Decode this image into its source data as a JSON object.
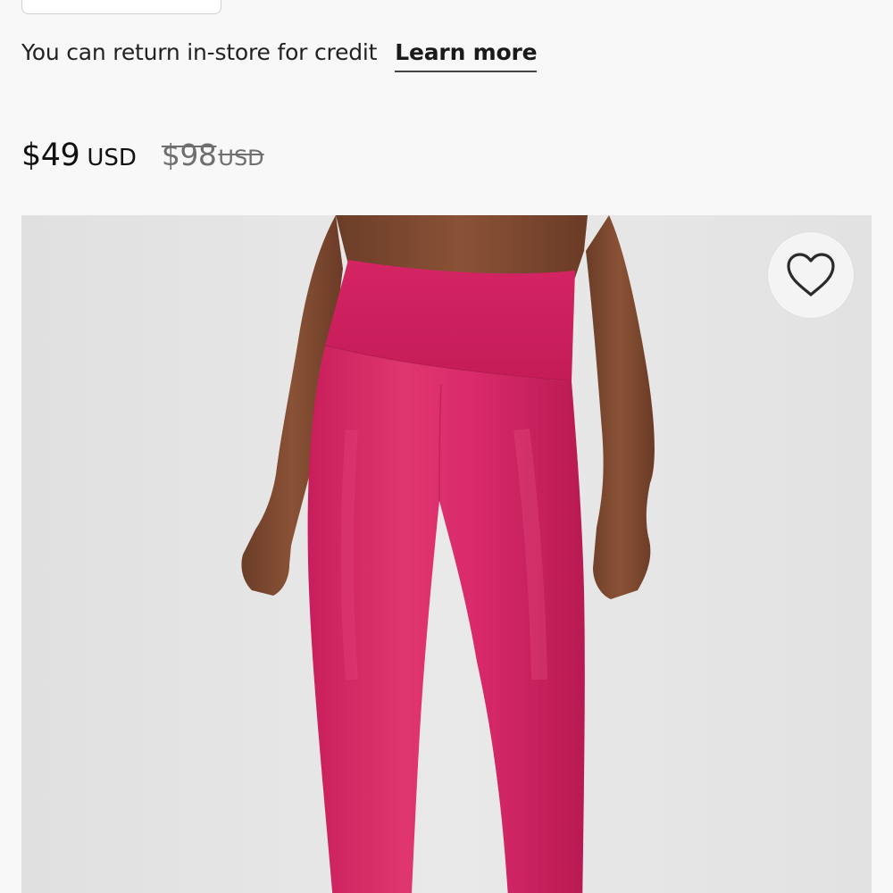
{
  "returns": {
    "text": "You can return in-store for credit",
    "link_label": "Learn more"
  },
  "price": {
    "current_amount": "$49",
    "current_currency": "USD",
    "original_amount": "$98",
    "original_currency": "USD"
  },
  "product_image": {
    "subject": "pink high-rise leggings",
    "leggings_color": "#d92a6a",
    "background_color": "#e4e4e4"
  },
  "wishlist": {
    "icon": "heart-outline-icon"
  }
}
